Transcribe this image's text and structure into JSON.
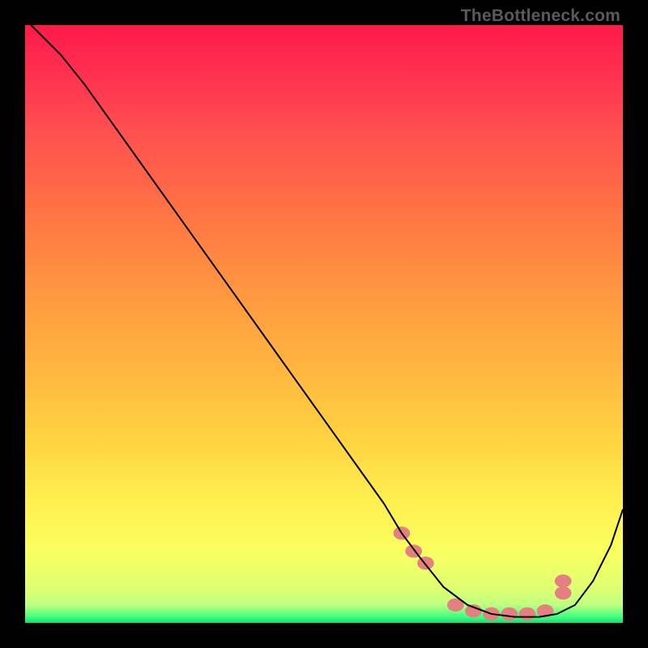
{
  "watermark": "TheBottleneck.com",
  "chart_data": {
    "type": "line",
    "title": "",
    "xlabel": "",
    "ylabel": "",
    "xlim": [
      0,
      100
    ],
    "ylim": [
      0,
      100
    ],
    "grid": false,
    "legend": false,
    "background_gradient_direction": "vertical",
    "background_gradient": [
      {
        "pos": 0.0,
        "color": "#ff1a4a"
      },
      {
        "pos": 0.18,
        "color": "#ff5050"
      },
      {
        "pos": 0.42,
        "color": "#ff9040"
      },
      {
        "pos": 0.68,
        "color": "#ffd040"
      },
      {
        "pos": 0.88,
        "color": "#faff60"
      },
      {
        "pos": 0.99,
        "color": "#40ff80"
      },
      {
        "pos": 1.0,
        "color": "#10e070"
      }
    ],
    "series": [
      {
        "name": "bottleneck-curve",
        "color": "#000000",
        "stroke_width": 2,
        "x": [
          1,
          3,
          6,
          10,
          15,
          20,
          25,
          30,
          35,
          40,
          45,
          50,
          55,
          60,
          63,
          66,
          70,
          74,
          78,
          82,
          86,
          89,
          92,
          95,
          98,
          100
        ],
        "y": [
          100,
          98,
          95,
          90,
          83,
          76,
          69,
          62,
          55,
          48,
          41,
          34,
          27,
          20,
          15,
          11,
          6,
          3,
          1.5,
          1,
          1,
          1.5,
          3,
          7,
          13,
          19
        ]
      },
      {
        "name": "highlight-dots",
        "type": "scatter",
        "color": "#e58080",
        "marker_size": 9,
        "x": [
          63,
          65,
          67,
          72,
          75,
          78,
          81,
          84,
          87,
          90,
          90
        ],
        "y": [
          15,
          12,
          10,
          3,
          2,
          1.5,
          1.5,
          1.5,
          2,
          5,
          7
        ]
      }
    ],
    "annotations": []
  }
}
